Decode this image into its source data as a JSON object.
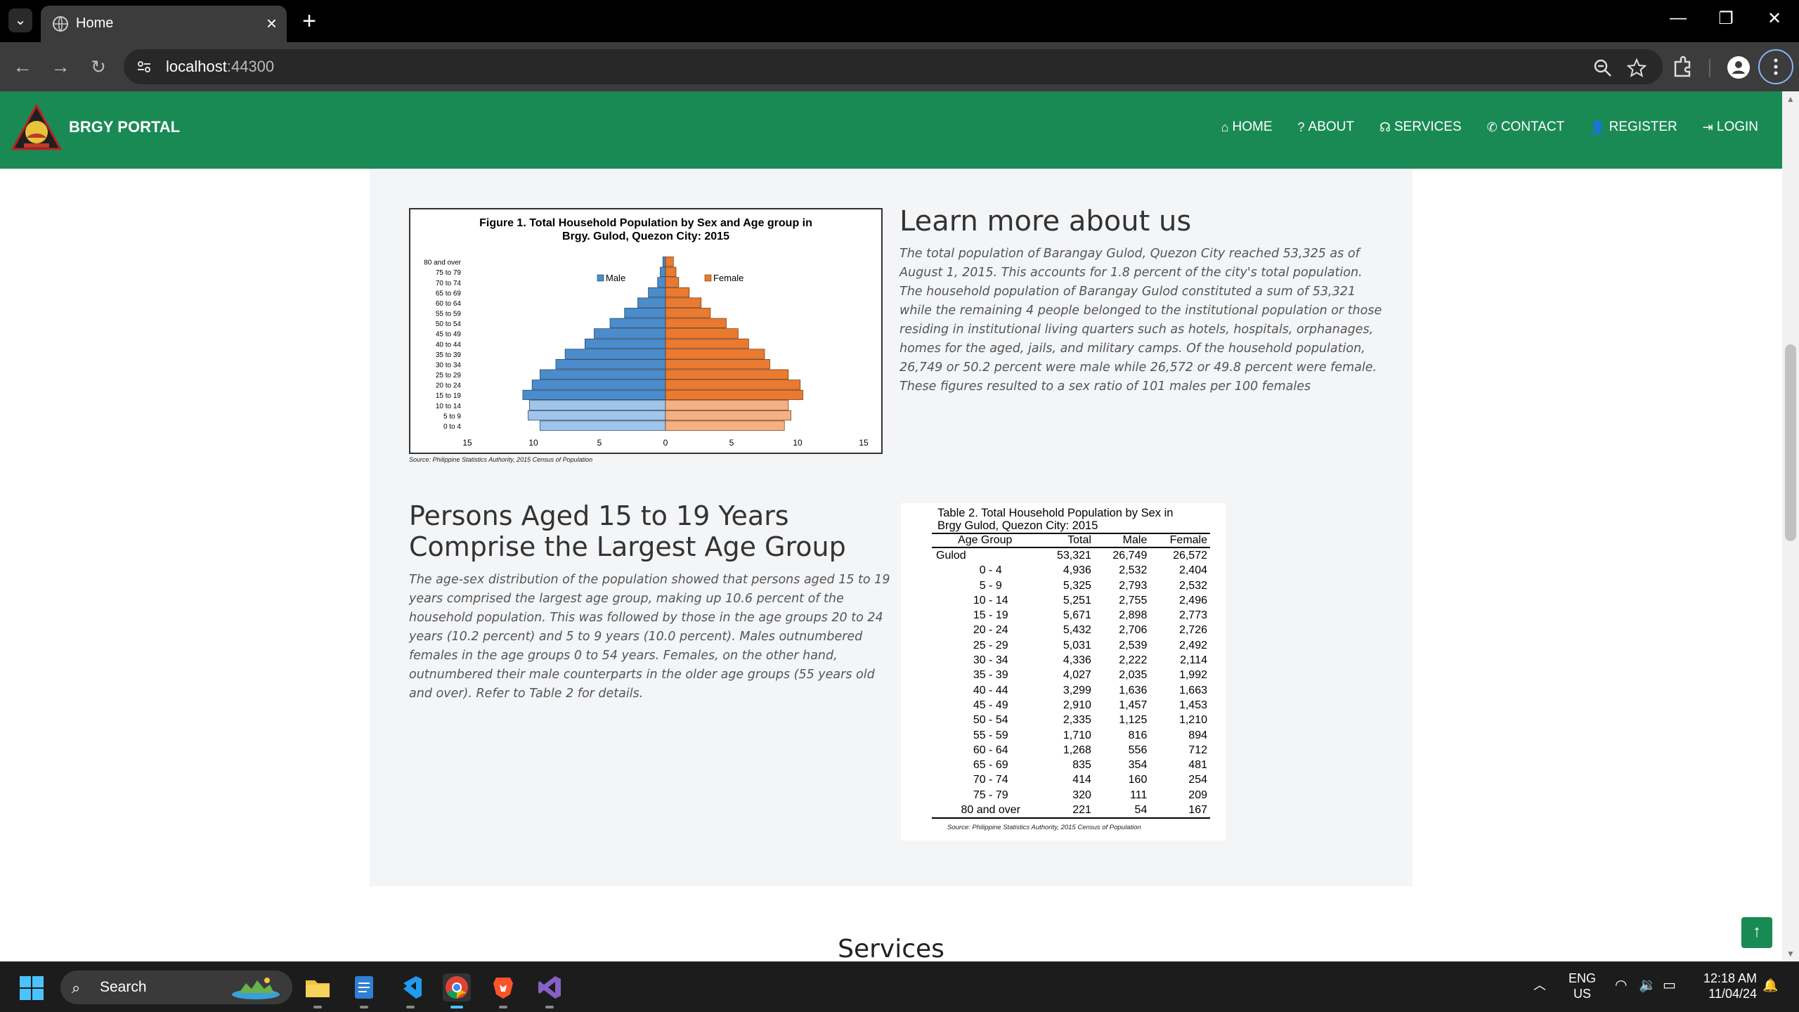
{
  "browser": {
    "tab_title": "Home",
    "url_host": "localhost",
    "url_port": ":44300"
  },
  "navbar": {
    "brand": "BRGY PORTAL",
    "links": [
      {
        "icon": "home-icon",
        "label": "HOME"
      },
      {
        "icon": "question-icon",
        "label": "ABOUT"
      },
      {
        "icon": "headset-icon",
        "label": "SERVICES"
      },
      {
        "icon": "phone-icon",
        "label": "CONTACT"
      },
      {
        "icon": "user-plus-icon",
        "label": "REGISTER"
      },
      {
        "icon": "login-icon",
        "label": "LOGIN"
      }
    ]
  },
  "about": {
    "title": "Learn more about us",
    "text": "The total population of Barangay Gulod, Quezon City reached 53,325 as of August 1, 2015. This accounts for 1.8 percent of the city's total population. The household population of Barangay Gulod constituted a sum of 53,321 while the remaining 4 people belonged to the institutional population or those residing in institutional living quarters such as hotels, hospitals, orphanages, homes for the aged, jails, and military camps. Of the household population, 26,749 or 50.2 percent were male while 26,572 or 49.8 percent were female. These figures resulted to a sex ratio of 101 males per 100 females"
  },
  "persons": {
    "title": "Persons Aged 15 to 19 Years Comprise the Largest Age Group",
    "text": "The age-sex distribution of the population showed that persons aged 15 to 19 years comprised the largest age group, making up 10.6 percent of the household population. This was followed by those in the age groups 20 to 24 years (10.2 percent) and 5 to 9 years (10.0 percent). Males outnumbered females in the age groups 0 to 54 years. Females, on the other hand, outnumbered their male counterparts in the older age groups (55 years old and over). Refer to Table 2 for details."
  },
  "figure_source": "Source: Philippine Statistics Authority, 2015 Census of Population",
  "table2": {
    "caption_line1": "Table 2. Total Household Population by Sex in",
    "caption_line2": "Brgy Gulod, Quezon City: 2015",
    "headers": [
      "Age Group",
      "Total",
      "Male",
      "Female"
    ],
    "rows": [
      [
        "Gulod",
        "53,321",
        "26,749",
        "26,572"
      ],
      [
        "0 - 4",
        "4,936",
        "2,532",
        "2,404"
      ],
      [
        "5 - 9",
        "5,325",
        "2,793",
        "2,532"
      ],
      [
        "10 - 14",
        "5,251",
        "2,755",
        "2,496"
      ],
      [
        "15 - 19",
        "5,671",
        "2,898",
        "2,773"
      ],
      [
        "20 - 24",
        "5,432",
        "2,706",
        "2,726"
      ],
      [
        "25 - 29",
        "5,031",
        "2,539",
        "2,492"
      ],
      [
        "30 - 34",
        "4,336",
        "2,222",
        "2,114"
      ],
      [
        "35 - 39",
        "4,027",
        "2,035",
        "1,992"
      ],
      [
        "40 - 44",
        "3,299",
        "1,636",
        "1,663"
      ],
      [
        "45 - 49",
        "2,910",
        "1,457",
        "1,453"
      ],
      [
        "50 - 54",
        "2,335",
        "1,125",
        "1,210"
      ],
      [
        "55 - 59",
        "1,710",
        "816",
        "894"
      ],
      [
        "60 - 64",
        "1,268",
        "556",
        "712"
      ],
      [
        "65 - 69",
        "835",
        "354",
        "481"
      ],
      [
        "70 - 74",
        "414",
        "160",
        "254"
      ],
      [
        "75 - 79",
        "320",
        "111",
        "209"
      ],
      [
        "80 and over",
        "221",
        "54",
        "167"
      ]
    ],
    "source": "Source: Philippine Statistics Authority, 2015 Census of Population"
  },
  "services_title": "Services",
  "taskbar": {
    "search_label": "Search",
    "lang_line1": "ENG",
    "lang_line2": "US",
    "time": "12:18 AM",
    "date": "11/04/24"
  },
  "colors": {
    "brand_green": "#1a8a55",
    "male": "#4a90d0",
    "female": "#e97a30"
  },
  "chart_data": {
    "type": "bar",
    "orientation": "horizontal-population-pyramid",
    "title": "Figure 1. Total Household Population by Sex and Age group in Brgy. Gulod, Quezon City: 2015",
    "categories": [
      "0 to 4",
      "5 to 9",
      "10 to 14",
      "15 to 19",
      "20 to 24",
      "25 to 29",
      "30 to 34",
      "35 to 39",
      "40 to 44",
      "45 to 49",
      "50 to 54",
      "55 to 59",
      "60 to 64",
      "65 to 69",
      "70 to 74",
      "75 to 79",
      "80 and over"
    ],
    "series": [
      {
        "name": "Male",
        "values": [
          9.5,
          10.4,
          10.3,
          10.8,
          10.1,
          9.5,
          8.3,
          7.6,
          6.1,
          5.4,
          4.2,
          3.1,
          2.1,
          1.3,
          0.6,
          0.4,
          0.2
        ]
      },
      {
        "name": "Female",
        "values": [
          9.0,
          9.5,
          9.3,
          10.4,
          10.2,
          9.3,
          7.9,
          7.5,
          6.3,
          5.5,
          4.6,
          3.4,
          2.7,
          1.8,
          1.0,
          0.8,
          0.6
        ]
      }
    ],
    "xticks": [
      "15",
      "10",
      "5",
      "0",
      "5",
      "10",
      "15"
    ],
    "xlim": [
      -15,
      15
    ],
    "legend": "top-center"
  }
}
